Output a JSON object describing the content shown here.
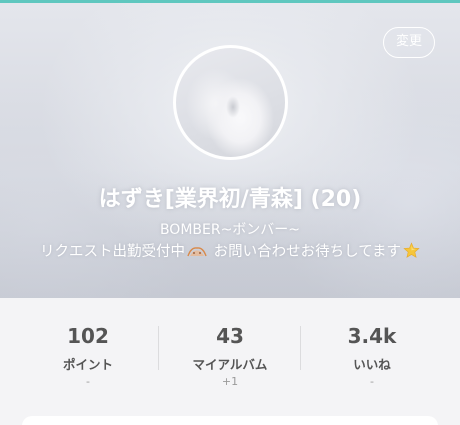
{
  "profile": {
    "change_button_label": "変更",
    "name": "はずき[業界初/青森] (20)",
    "catchphrase": "BOMBER~ボンバー~",
    "message_part1": "リクエスト出勤受付中",
    "message_part2": " お問い合わせお待ちしてます",
    "emoji_1": "bow-emoji",
    "emoji_2": "star-emoji"
  },
  "stats": [
    {
      "value": "102",
      "label": "ポイント",
      "sub": "-"
    },
    {
      "value": "43",
      "label": "マイアルバム",
      "sub": "+1"
    },
    {
      "value": "3.4k",
      "label": "いいね",
      "sub": "-"
    }
  ],
  "colors": {
    "accent": "#5fc7bf",
    "stat_text": "#555555",
    "sub_text": "#9a9a9a",
    "background": "#f4f4f6"
  }
}
